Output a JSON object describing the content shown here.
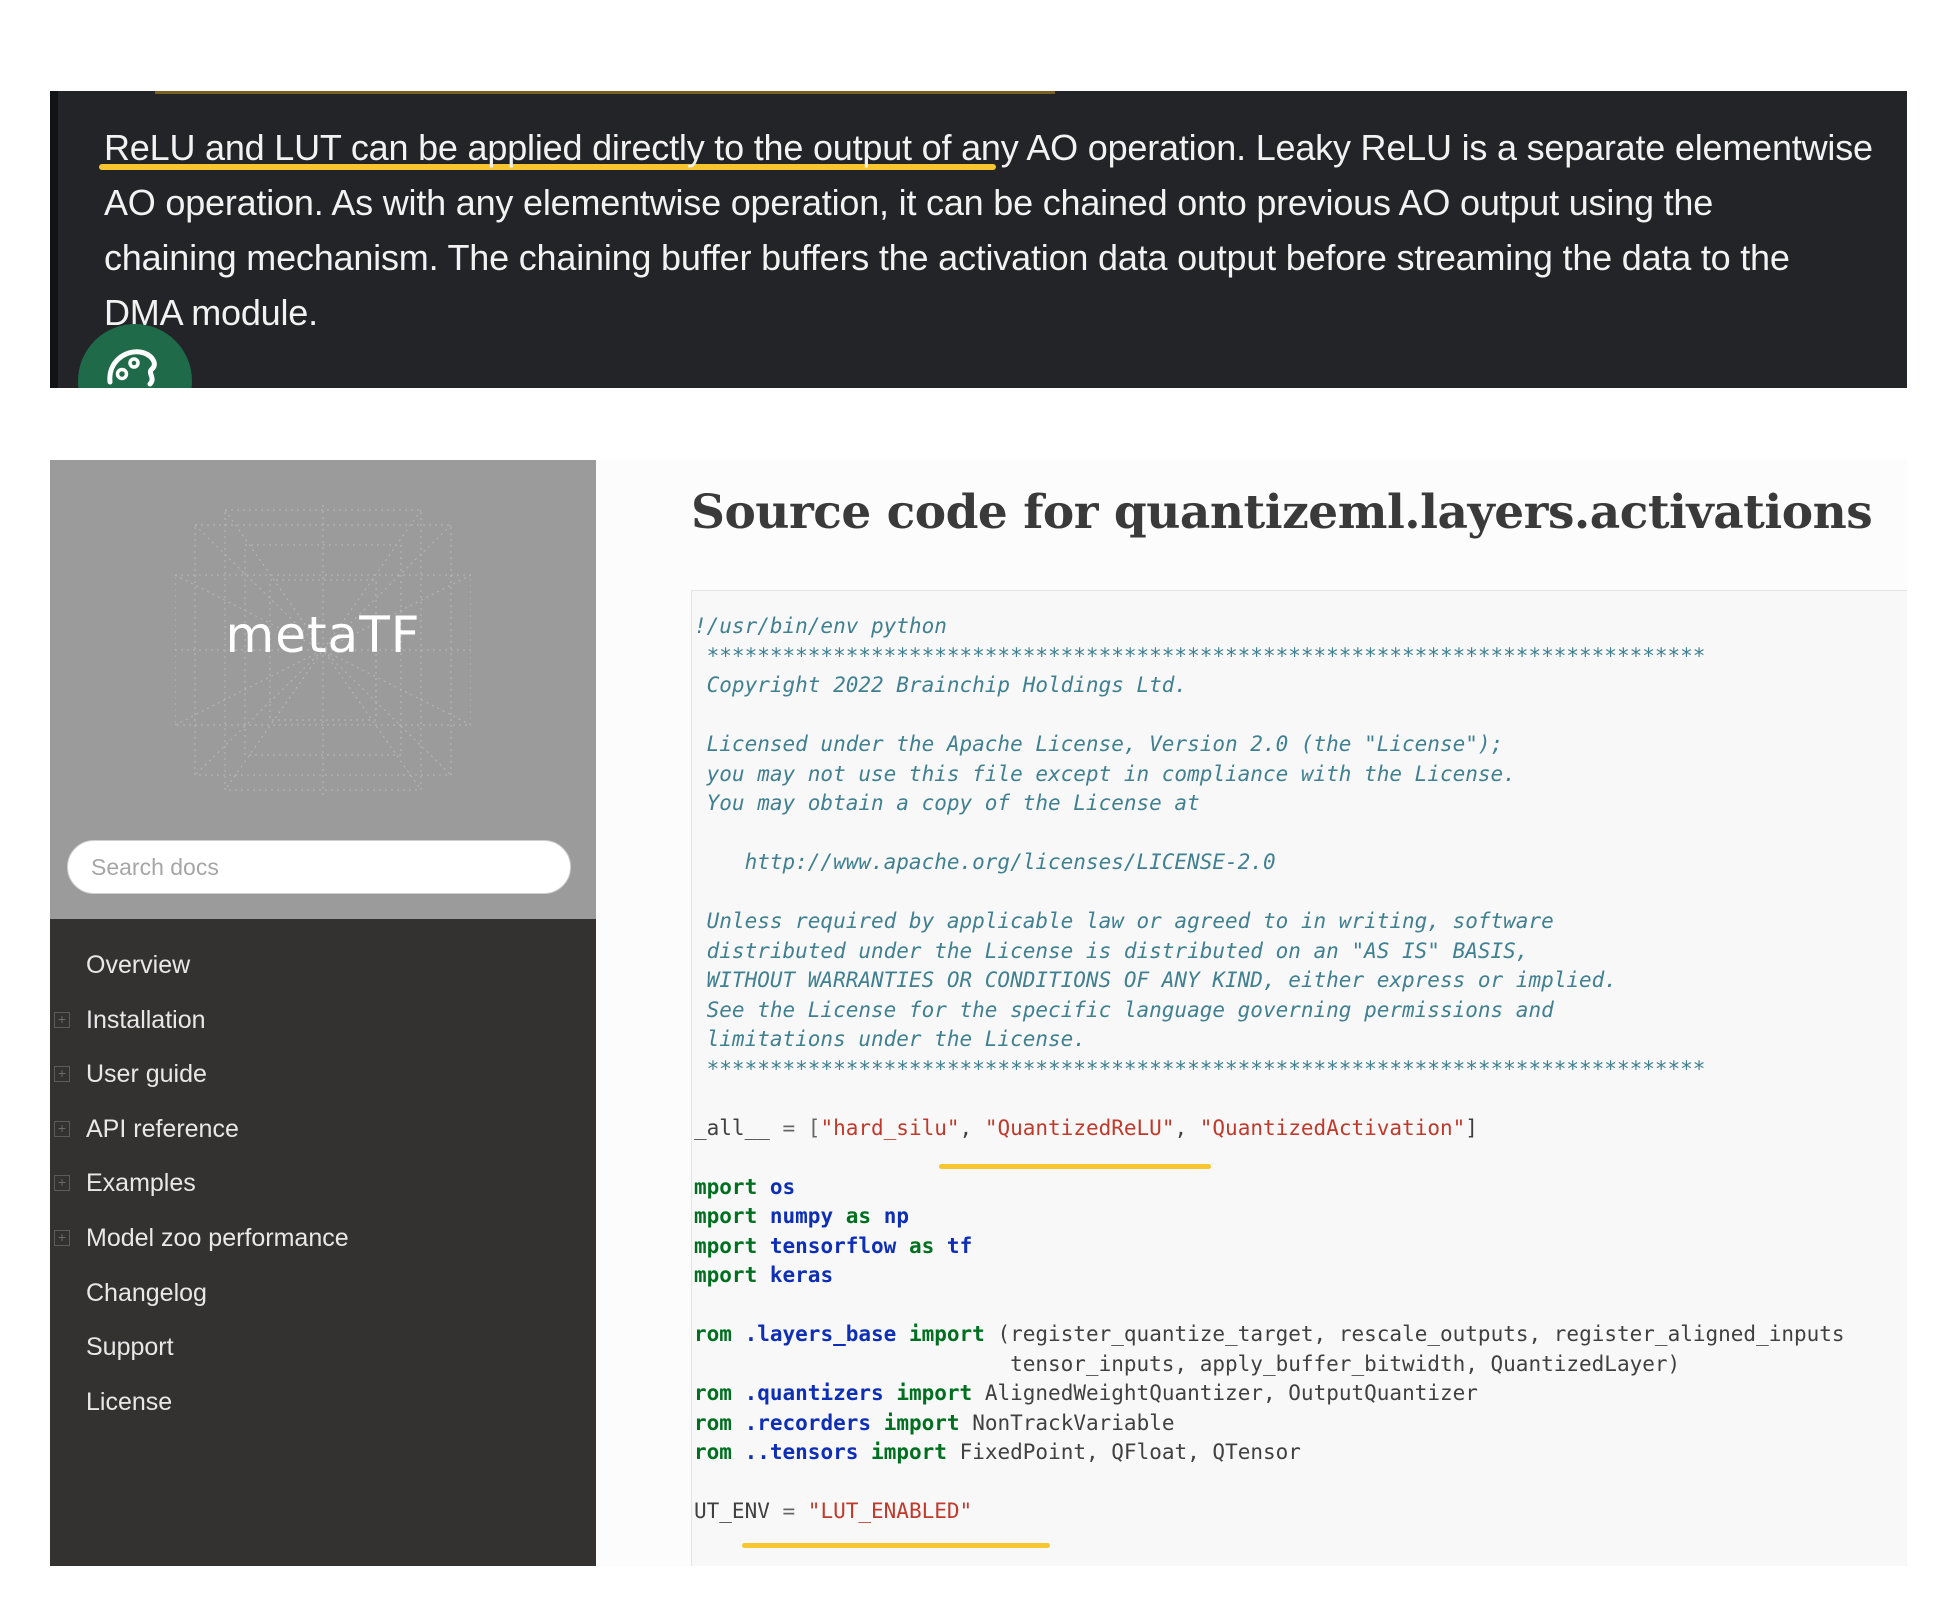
{
  "excerpt": {
    "line1_highlighted": "ReLU and LUT can be applied directly to the output of any AO operation.",
    "line1_rest": " Leaky ReLU is a separate elementwise",
    "line2": "AO operation. As with any elementwise operation, it can be chained onto previous AO output using the",
    "line3": "chaining mechanism. The chaining buffer buffers the activation data output before streaming the data to the",
    "line4": "DMA module.",
    "highlight_color": "#f7c52d",
    "avatar_icon": "palette-icon"
  },
  "sidebar": {
    "logo": "metaTF",
    "search_placeholder": "Search docs",
    "nav": [
      {
        "label": "Overview",
        "expandable": false
      },
      {
        "label": "Installation",
        "expandable": true
      },
      {
        "label": "User guide",
        "expandable": true
      },
      {
        "label": "API reference",
        "expandable": true
      },
      {
        "label": "Examples",
        "expandable": true
      },
      {
        "label": "Model zoo performance",
        "expandable": true
      },
      {
        "label": "Changelog",
        "expandable": false
      },
      {
        "label": "Support",
        "expandable": false
      },
      {
        "label": "License",
        "expandable": false
      }
    ]
  },
  "main": {
    "title": "Source code for quantizeml.layers.activations",
    "code": {
      "shebang": "!/usr/bin/env python",
      "stars": " *******************************************************************************",
      "copyright": " Copyright 2022 Brainchip Holdings Ltd.",
      "lic1": " Licensed under the Apache License, Version 2.0 (the \"License\");",
      "lic2": " you may not use this file except in compliance with the License.",
      "lic3": " You may obtain a copy of the License at",
      "url": "    http://www.apache.org/licenses/LICENSE-2.0",
      "unless1": " Unless required by applicable law or agreed to in writing, software",
      "unless2": " distributed under the License is distributed on an \"AS IS\" BASIS,",
      "unless3": " WITHOUT WARRANTIES OR CONDITIONS OF ANY KIND, either express or implied.",
      "unless4": " See the License for the specific language governing permissions and",
      "unless5": " limitations under the License.",
      "all_name": "_all__",
      "all_eq": " = [",
      "all_s1": "\"hard_silu\"",
      "all_s2": "\"QuantizedReLU\"",
      "all_s3": "\"QuantizedActivation\"",
      "all_end": "]",
      "kw_mport": "mport",
      "kw_rom": "rom",
      "kw_import": "import",
      "kw_as": "as",
      "mod_os": "os",
      "mod_numpy": "numpy",
      "mod_np": "np",
      "mod_tensorflow": "tensorflow",
      "mod_tf": "tf",
      "mod_keras": "keras",
      "from1_mod": ".layers_base",
      "from1_names": "(register_quantize_target, rescale_outputs, register_aligned_inputs",
      "from1_cont": "                         tensor_inputs, apply_buffer_bitwidth, QuantizedLayer)",
      "from2_mod": ".quantizers",
      "from2_names": "AlignedWeightQuantizer, OutputQuantizer",
      "from3_mod": ".recorders",
      "from3_names": "NonTrackVariable",
      "from4_mod": "..tensors",
      "from4_names": "FixedPoint, QFloat, QTensor",
      "lut_name": "UT_ENV",
      "lut_eq": " = ",
      "lut_val": "\"LUT_ENABLED\""
    }
  }
}
